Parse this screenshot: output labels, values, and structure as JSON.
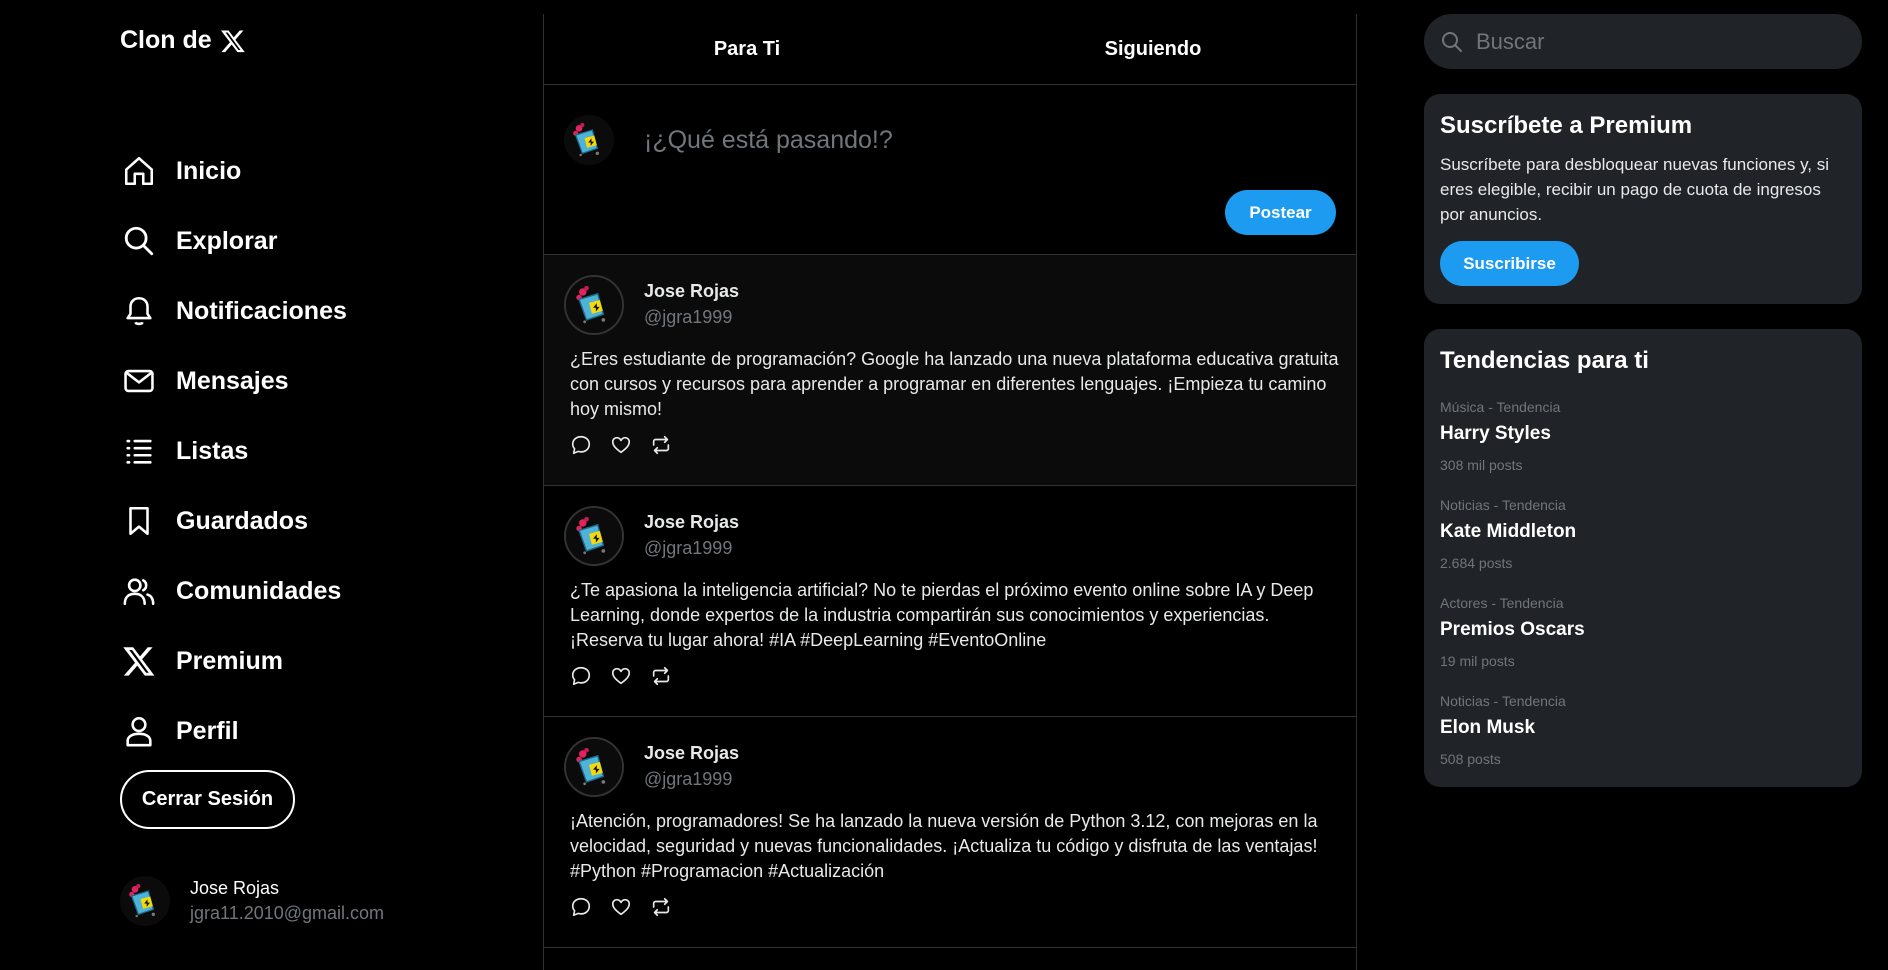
{
  "brand": {
    "title": "Clon de",
    "icon": "x-logo-icon"
  },
  "nav": {
    "items": [
      {
        "label": "Inicio",
        "icon": "home-icon"
      },
      {
        "label": "Explorar",
        "icon": "search-icon"
      },
      {
        "label": "Notificaciones",
        "icon": "bell-icon"
      },
      {
        "label": "Mensajes",
        "icon": "mail-icon"
      },
      {
        "label": "Listas",
        "icon": "list-icon"
      },
      {
        "label": "Guardados",
        "icon": "bookmark-icon"
      },
      {
        "label": "Comunidades",
        "icon": "people-icon"
      },
      {
        "label": "Premium",
        "icon": "x-logo-icon"
      },
      {
        "label": "Perfil",
        "icon": "user-icon"
      }
    ],
    "logout_label": "Cerrar Sesión"
  },
  "profile": {
    "name": "Jose Rojas",
    "email": "jgra11.2010@gmail.com"
  },
  "tabs": [
    {
      "label": "Para Ti"
    },
    {
      "label": "Siguiendo"
    }
  ],
  "composer": {
    "placeholder": "¡¿Qué está pasando!?",
    "post_label": "Postear"
  },
  "tweets": [
    {
      "name": "Jose Rojas",
      "handle": "@jgra1999",
      "text": "¿Eres estudiante de programación? Google ha lanzado una nueva plataforma educativa gratuita con cursos y recursos para aprender a programar en diferentes lenguajes. ¡Empieza tu camino hoy mismo!"
    },
    {
      "name": "Jose Rojas",
      "handle": "@jgra1999",
      "text": "¿Te apasiona la inteligencia artificial? No te pierdas el próximo evento online sobre IA y Deep Learning, donde expertos de la industria compartirán sus conocimientos y experiencias. ¡Reserva tu lugar ahora! #IA #DeepLearning #EventoOnline"
    },
    {
      "name": "Jose Rojas",
      "handle": "@jgra1999",
      "text": "¡Atención, programadores! Se ha lanzado la nueva versión de Python 3.12, con mejoras en la velocidad, seguridad y nuevas funcionalidades. ¡Actualiza tu código y disfruta de las ventajas! #Python #Programacion #Actualización"
    }
  ],
  "search": {
    "placeholder": "Buscar"
  },
  "premium": {
    "title": "Suscríbete a Premium",
    "text": "Suscríbete para desbloquear nuevas funciones y, si eres elegible, recibir un pago de cuota de ingresos por anuncios.",
    "button_label": "Suscribirse"
  },
  "trends": {
    "title": "Tendencias para ti",
    "items": [
      {
        "category": "Música - Tendencia",
        "name": "Harry Styles",
        "count": "308 mil posts"
      },
      {
        "category": "Noticias - Tendencia",
        "name": "Kate Middleton",
        "count": "2.684 posts"
      },
      {
        "category": "Actores - Tendencia",
        "name": "Premios Oscars",
        "count": "19 mil posts"
      },
      {
        "category": "Noticias - Tendencia",
        "name": "Elon Musk",
        "count": "508 posts"
      }
    ]
  },
  "colors": {
    "accent": "#1d9bf0",
    "background": "#000000",
    "card": "#202327",
    "muted": "#71767b"
  }
}
